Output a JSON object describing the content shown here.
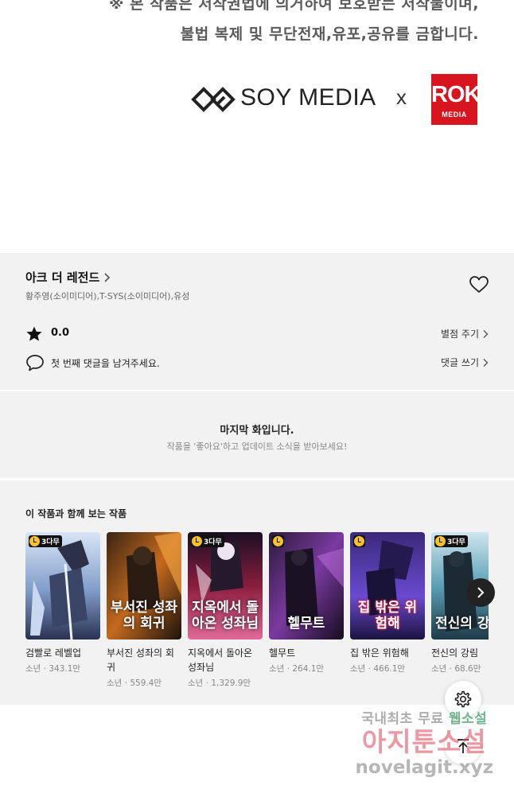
{
  "notice": {
    "line1": "※ 본 작품은 저작권법에 의거하여 보호받는 저작물이며,",
    "line2": "불법 복제 및 무단전재,유포,공유를 금합니다."
  },
  "logos": {
    "soy": "SOY MEDIA",
    "times": "x",
    "rok_big": "ROK",
    "rok_small": "MEDIA"
  },
  "series": {
    "title": "아크 더 레전드",
    "authors": "황주영(소이미디어),T-SYS(소이미디어),유성",
    "rating": "0.0",
    "rate_link": "별점 주기",
    "comment_prompt": "첫 번째 댓글을 남겨주세요.",
    "comment_link": "댓글 쓰기"
  },
  "last_episode": {
    "title": "마지막 화입니다.",
    "subtitle": "작품을 '좋아요'하고 업데이트 소식을 받아보세요!"
  },
  "recommendations": {
    "heading": "이 작품과 함께 보는 작품",
    "badge_text": "3다무",
    "items": [
      {
        "title": "검빨로 레벨업",
        "meta": "소년 · 343.1만",
        "badge": true,
        "cover_text": ""
      },
      {
        "title": "부서진 성좌의 회귀",
        "meta": "소년 · 559.4만",
        "badge": false,
        "cover_text": "부서진 성좌의 회귀"
      },
      {
        "title": "지옥에서 돌아온 성좌님",
        "meta": "소년 · 1,329.9만",
        "badge": true,
        "cover_text": "지옥에서 돌아온 성좌님"
      },
      {
        "title": "헬무트",
        "meta": "소년 · 264.1만",
        "badge": false,
        "cover_text": "헬무트"
      },
      {
        "title": "집 밖은 위험해",
        "meta": "소년 · 466.1만",
        "badge": false,
        "cover_text": "집 밖은 위험해"
      },
      {
        "title": "전신의 강림",
        "meta": "소년 · 68.6만",
        "badge": true,
        "cover_text": "전신의 강림"
      }
    ]
  },
  "watermark": {
    "line1_a": "국내최초 무료 ",
    "line1_b": "웹소설",
    "line2": "아지툰소설",
    "line3": "novelagit.xyz"
  },
  "colors": {
    "rok_red": "#d7151f",
    "panel_bg": "#f2f2f2",
    "badge_yellow": "#f6c230"
  }
}
